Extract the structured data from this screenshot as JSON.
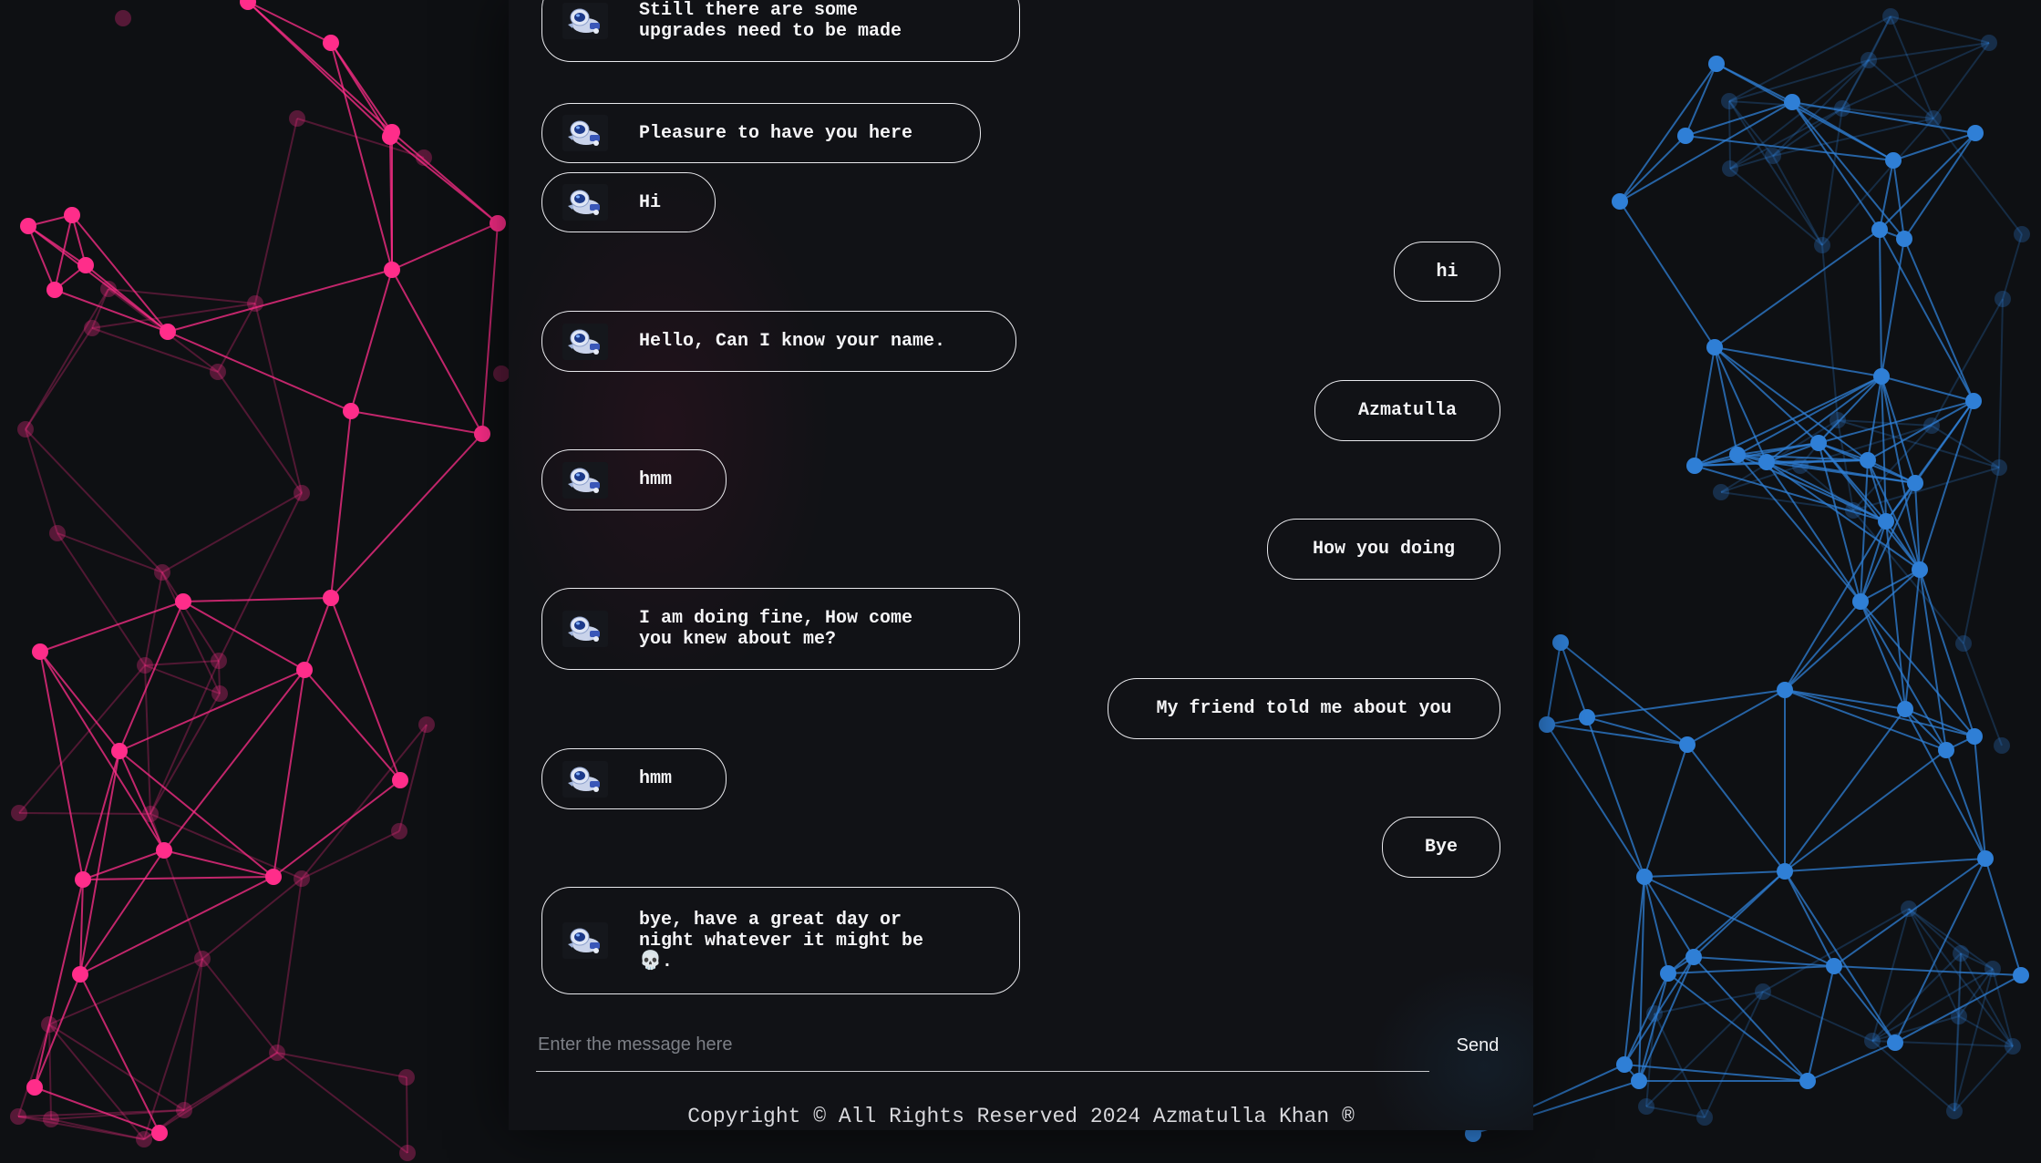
{
  "theme": {
    "pink": "#ff2d8a",
    "blue": "#2f7fd6",
    "background": "#0e1013",
    "panel": "#111216"
  },
  "chat": {
    "messages": [
      {
        "sender": "bot",
        "text": "Still there are some\nupgrades need to be made"
      },
      {
        "sender": "bot",
        "text": "Pleasure to have you here"
      },
      {
        "sender": "bot",
        "text": "Hi"
      },
      {
        "sender": "user",
        "text": "hi"
      },
      {
        "sender": "bot",
        "text": "Hello, Can I know your name."
      },
      {
        "sender": "user",
        "text": "Azmatulla"
      },
      {
        "sender": "bot",
        "text": "hmm"
      },
      {
        "sender": "user",
        "text": "How you doing"
      },
      {
        "sender": "bot",
        "text": "I am doing fine, How come\nyou knew about me?"
      },
      {
        "sender": "user",
        "text": "My friend told me about you"
      },
      {
        "sender": "bot",
        "text": "hmm"
      },
      {
        "sender": "user",
        "text": "Bye"
      },
      {
        "sender": "bot",
        "text": "bye, have a great day or\nnight whatever it might be\n💀."
      }
    ],
    "bot_avatar_icon": "astronaut-icon"
  },
  "input": {
    "placeholder": "Enter the message here",
    "value": ""
  },
  "send_label": "Send",
  "footer": {
    "copyright": "Copyright © All Rights Reserved 2024 Azmatulla Khan ®"
  }
}
